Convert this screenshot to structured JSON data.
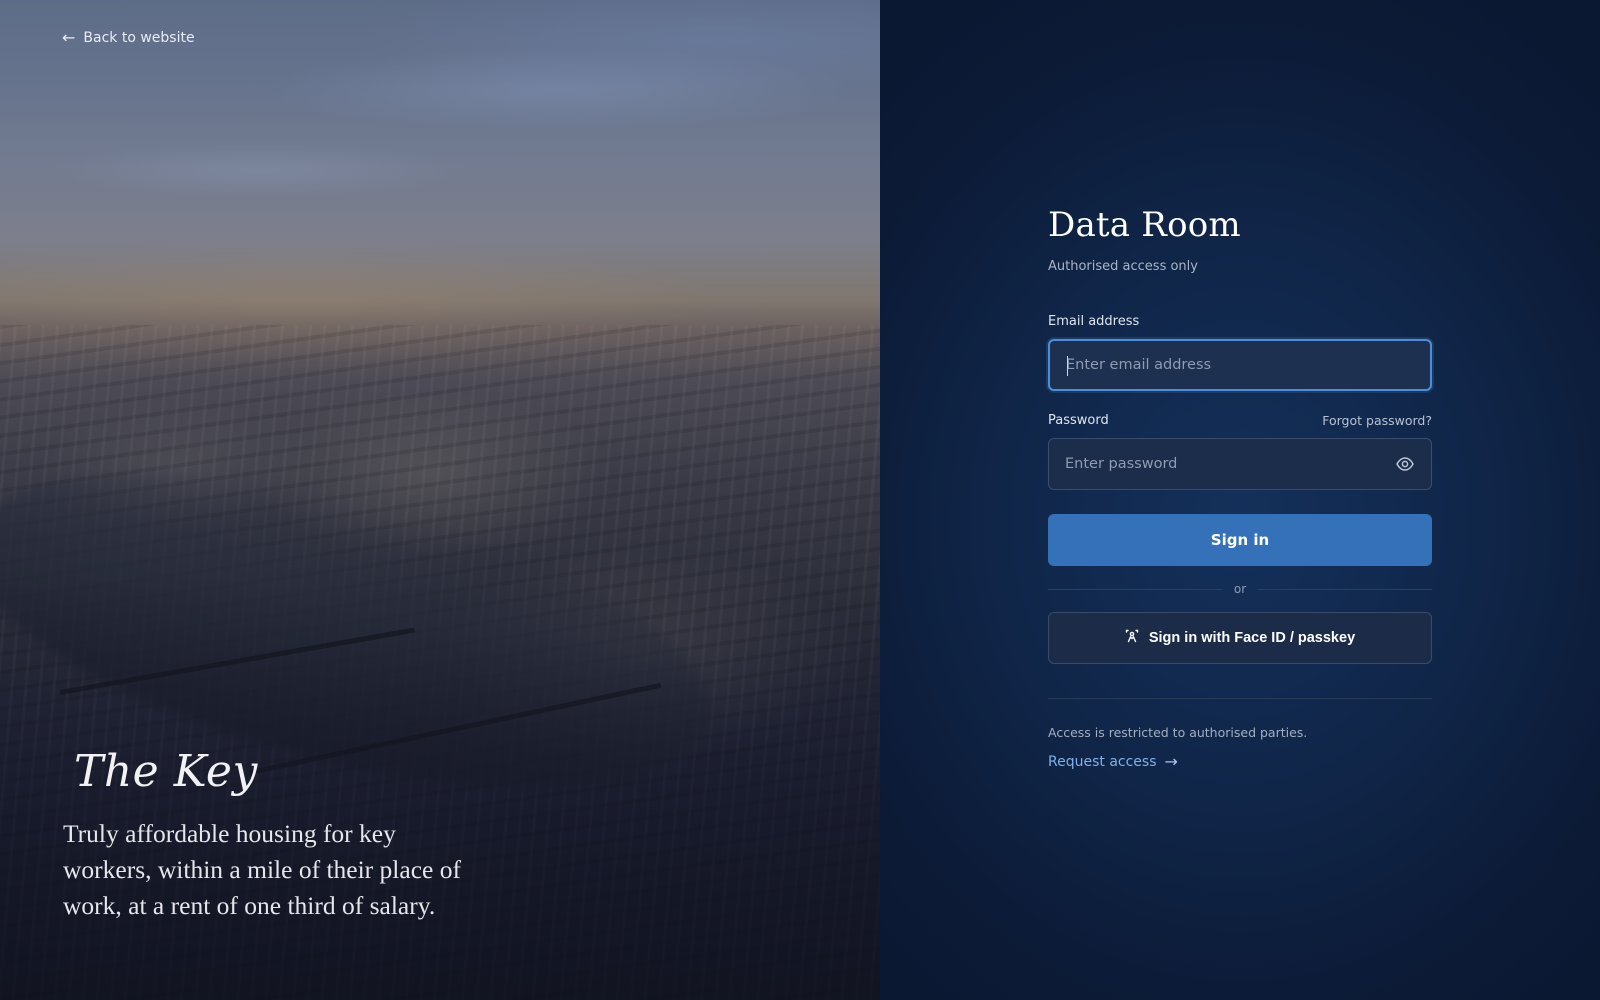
{
  "left_panel": {
    "back_link": {
      "arrow": "←",
      "label": "Back to website"
    },
    "brand": "The Key",
    "tagline": "Truly affordable housing for key workers, within a mile of their place of work, at a rent of one third of salary."
  },
  "login": {
    "title": "Data Room",
    "subtitle": "Authorised access only",
    "email": {
      "label": "Email address",
      "placeholder": "Enter email address",
      "value": ""
    },
    "password": {
      "label": "Password",
      "placeholder": "Enter password",
      "value": "",
      "forgot_label": "Forgot password?",
      "toggle_icon": "eye-icon"
    },
    "sign_in_label": "Sign in",
    "divider_label": "or",
    "passkey": {
      "icon": "face-id-icon",
      "label": "Sign in with Face ID / passkey"
    },
    "restricted_note": "Access is restricted to authorised parties.",
    "request_access": {
      "label": "Request access",
      "arrow": "→"
    }
  },
  "colors": {
    "primary_button": "#3571b9",
    "link": "#7fb0ea",
    "focus_ring": "#4d8fd6",
    "panel_background": "#0c1b37"
  }
}
